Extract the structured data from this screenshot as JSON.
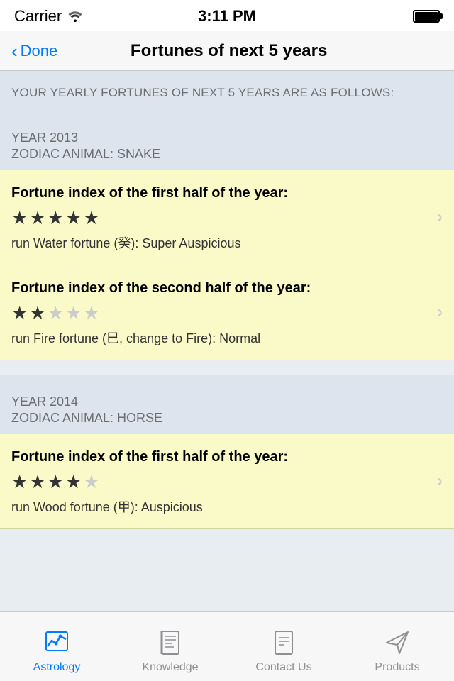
{
  "statusBar": {
    "carrier": "Carrier",
    "time": "3:11 PM"
  },
  "navBar": {
    "backLabel": "Done",
    "title": "Fortunes of next 5 years"
  },
  "introText": "YOUR YEARLY FORTUNES OF NEXT 5 YEARS ARE AS FOLLOWS:",
  "years": [
    {
      "year": "YEAR 2013",
      "zodiac": "ZODIAC ANIMAL: SNAKE",
      "fortunes": [
        {
          "title": "Fortune index of the first half of the year:",
          "stars": 5,
          "starsTotal": 5,
          "description": "run Water fortune (癸): Super Auspicious"
        },
        {
          "title": "Fortune index of the second half of the year:",
          "stars": 2,
          "starsTotal": 5,
          "description": "run Fire fortune (巳, change to Fire): Normal"
        }
      ]
    },
    {
      "year": "YEAR 2014",
      "zodiac": "ZODIAC ANIMAL: HORSE",
      "fortunes": [
        {
          "title": "Fortune index of the first half of the year:",
          "stars": 4,
          "starsTotal": 5,
          "description": "run Wood fortune (甲): Auspicious"
        }
      ]
    }
  ],
  "tabBar": {
    "items": [
      {
        "label": "Astrology",
        "active": true
      },
      {
        "label": "Knowledge",
        "active": false
      },
      {
        "label": "Contact Us",
        "active": false
      },
      {
        "label": "Products",
        "active": false
      }
    ]
  }
}
